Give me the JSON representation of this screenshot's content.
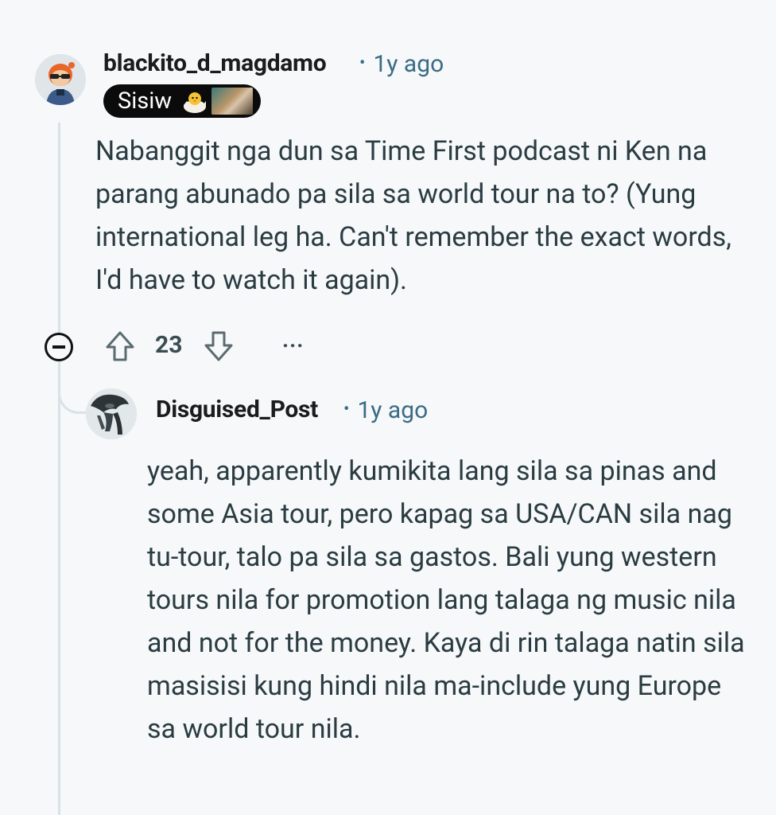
{
  "comment": {
    "username": "blackito_d_magdamo",
    "separator": "•",
    "time": "1y ago",
    "flair_text": "Sisiw",
    "body": "Nabanggit nga dun sa Time First podcast ni Ken na parang abunado pa sila sa world tour na to? (Yung international leg ha. Can't remember the exact words, I'd have to watch it again).",
    "vote_count": "23",
    "more_label": "...",
    "icons": {
      "avatar": "avatar-icon",
      "collapse": "collapse-icon",
      "upvote": "upvote-icon",
      "downvote": "downvote-icon",
      "flair_emoji": "chick-emoji-icon"
    }
  },
  "reply": {
    "username": "Disguised_Post",
    "separator": "•",
    "time": "1y ago",
    "body": "yeah, apparently kumikita lang sila sa pinas and some Asia tour, pero kapag sa USA/CAN sila nag tu-tour, talo pa sila sa gastos. Bali yung western tours nila for promotion lang talaga ng music nila and not for the money. Kaya di rin talaga natin sila masisisi kung hindi nila ma-include yung Europe sa world tour nila."
  },
  "colors": {
    "background": "#f6f8f9",
    "meta_blue": "#3b6b86",
    "thread_line": "#d7e3e7",
    "flair_bg": "#0b0b0b"
  }
}
